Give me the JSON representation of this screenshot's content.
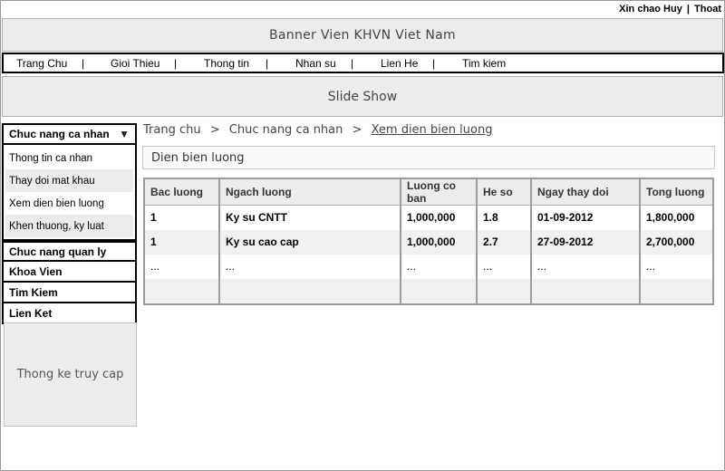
{
  "header": {
    "greeting": "Xin chao Huy",
    "separator": "|",
    "logout": "Thoat"
  },
  "banner": {
    "text": "Banner Vien KHVN Viet Nam"
  },
  "nav": {
    "items": [
      "Trang Chu",
      "Gioi Thieu",
      "Thong tin",
      "Nhan su",
      "Lien He",
      "Tim kiem"
    ],
    "separator": "|"
  },
  "slideshow": {
    "text": "Slide Show"
  },
  "sidebar": {
    "personal_header": "Chuc nang ca nhan",
    "personal_items": [
      "Thong tin ca nhan",
      "Thay doi mat khau",
      "Xem dien bien luong",
      "Khen thuong, ky luat"
    ],
    "links": [
      "Chuc nang quan ly",
      "Khoa Vien",
      "Tim Kiem",
      "Lien Ket"
    ],
    "stats": "Thong ke truy cap"
  },
  "breadcrumb": {
    "items": [
      "Trang chu",
      "Chuc nang ca nhan",
      "Xem dien bien luong"
    ],
    "separator": ">"
  },
  "section": {
    "title": "Dien bien luong"
  },
  "table": {
    "columns": [
      "Bac luong",
      "Ngach luong",
      "Luong co ban",
      "He so",
      "Ngay thay doi",
      "Tong luong"
    ],
    "rows": [
      [
        "1",
        "Ky su CNTT",
        "1,000,000",
        "1.8",
        "01-09-2012",
        "1,800,000"
      ],
      [
        "1",
        "Ky su cao cap",
        "1,000,000",
        "2.7",
        "27-09-2012",
        "2,700,000"
      ],
      [
        "...",
        "...",
        "...",
        "...",
        "...",
        "..."
      ],
      [
        "",
        "",
        "",
        "",
        "",
        ""
      ]
    ]
  }
}
